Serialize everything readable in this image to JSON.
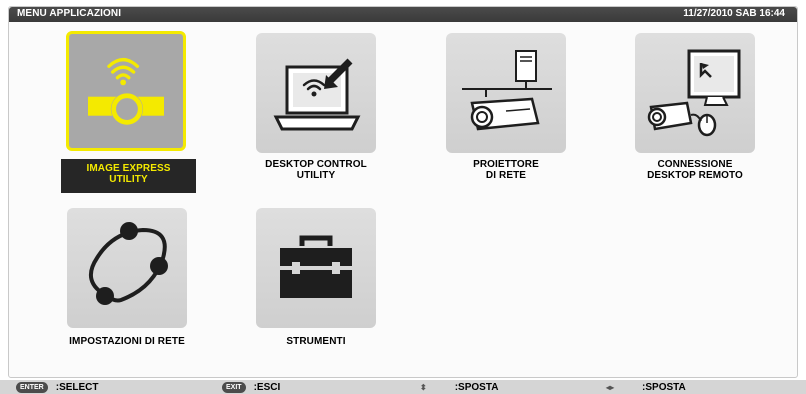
{
  "header": {
    "title": "MENU APPLICAZIONI",
    "datetime": "11/27/2010 SAB 16:44"
  },
  "apps": [
    {
      "line1": "IMAGE EXPRESS",
      "line2": "UTILITY",
      "icon": "wireless-projector-icon",
      "selected": true
    },
    {
      "line1": "DESKTOP CONTROL",
      "line2": "UTILITY",
      "icon": "laptop-remote-icon",
      "selected": false
    },
    {
      "line1": "PROIETTORE",
      "line2": "DI RETE",
      "icon": "network-projector-icon",
      "selected": false
    },
    {
      "line1": "CONNESSIONE",
      "line2": "DESKTOP REMOTO",
      "icon": "remote-desktop-icon",
      "selected": false
    },
    {
      "line1": "IMPOSTAZIONI DI RETE",
      "line2": "",
      "icon": "network-settings-icon",
      "selected": false
    },
    {
      "line1": "STRUMENTI",
      "line2": "",
      "icon": "toolbox-icon",
      "selected": false
    }
  ],
  "statusbar": {
    "enter_key": "ENTER",
    "enter_action": ":SELECT",
    "exit_key": "EXIT",
    "exit_action": ":ESCI",
    "updown_glyph": "⬍",
    "updown_action": ":SPOSTA",
    "leftright_glyph": "◂▸",
    "leftright_action": ":SPOSTA"
  },
  "colors": {
    "highlight": "#f4ea00",
    "titlebar": "#444444",
    "tile": "#d6d6d6"
  }
}
